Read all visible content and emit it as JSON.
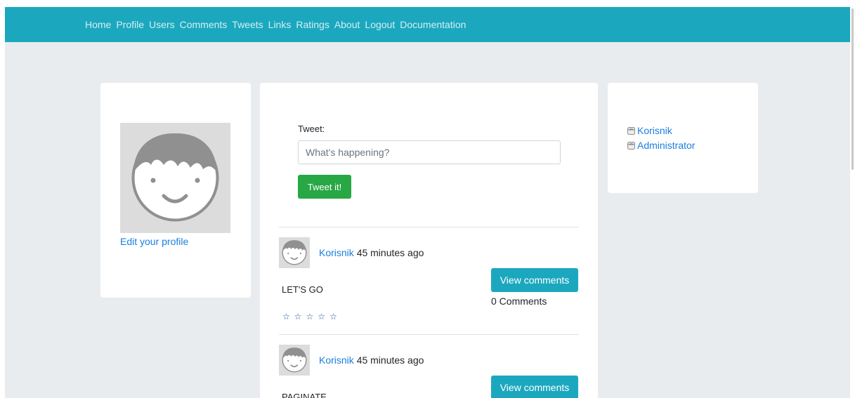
{
  "nav": {
    "items": [
      {
        "label": "Home"
      },
      {
        "label": "Profile"
      },
      {
        "label": "Users"
      },
      {
        "label": "Comments"
      },
      {
        "label": "Tweets"
      },
      {
        "label": "Links"
      },
      {
        "label": "Ratings"
      },
      {
        "label": "About"
      },
      {
        "label": "Logout"
      },
      {
        "label": "Documentation"
      }
    ]
  },
  "profile": {
    "avatar_icon": "default-avatar-icon",
    "edit_link": "Edit your profile"
  },
  "composer": {
    "label": "Tweet:",
    "placeholder": "What's happening?",
    "submit_label": "Tweet it!"
  },
  "posts": [
    {
      "author": "Korisnik",
      "time": "45 minutes ago",
      "text": "LET'S GO",
      "view_label": "View comments",
      "comment_count": "0 Comments",
      "stars": [
        "☆",
        "☆",
        "☆",
        "☆",
        "☆"
      ]
    },
    {
      "author": "Korisnik",
      "time": "45 minutes ago",
      "text": "PAGINATE",
      "view_label": "View comments"
    }
  ],
  "users": [
    {
      "name": "Korisnik",
      "icon": "user-icon"
    },
    {
      "name": "Administrator",
      "icon": "user-icon"
    }
  ],
  "colors": {
    "navbar": "#1ba8bf",
    "link": "#1a7fe0",
    "success": "#28a745",
    "info": "#1ba8bf",
    "background": "#e9ecef"
  }
}
